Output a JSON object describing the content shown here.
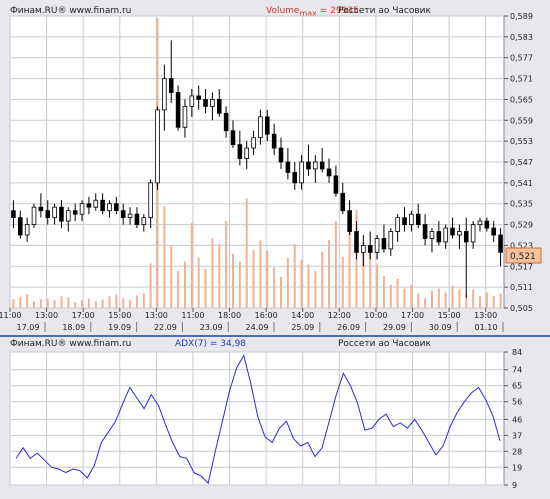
{
  "top_panel": {
    "source": "Финам.RU®  www.finam.ru",
    "volume_label_prefix": "Volume",
    "volume_label_sub": "max",
    "volume_label_value": " = 29935",
    "instrument": "Россети ао Часовик",
    "last_price": "0,521"
  },
  "bottom_panel": {
    "source": "Финам.RU®  www.finam.ru",
    "indicator": "ADX(7) = 34,98",
    "instrument": "Россети ао Часовик"
  },
  "colors": {
    "up_body": "#ffffff",
    "down_body": "#000000",
    "volume": "#f2b190",
    "adx_line": "#2b2bd8",
    "grid": "#c9c9d2",
    "price_box": "#f6c29d",
    "sep": "#4a6fb0"
  },
  "chart_data": [
    {
      "type": "candlestick",
      "title": "Россети ао Часовик",
      "y_ticks": [
        "0,589",
        "0,583",
        "0,577",
        "0,571",
        "0,565",
        "0,559",
        "0,553",
        "0,547",
        "0,541",
        "0,535",
        "0,529",
        "0,523",
        "0,517",
        "0,511",
        "0,505"
      ],
      "ylim": [
        0.505,
        0.589
      ],
      "time_labels": [
        "11:00",
        "13:00",
        "17:00",
        "15:00",
        "13:00",
        "11:00",
        "18:00",
        "16:00",
        "14:00",
        "12:00",
        "10:00",
        "17:00",
        "15:00",
        "13:00"
      ],
      "date_labels": [
        "17.09",
        "18.09",
        "19.09",
        "22.09",
        "23.09",
        "24.09",
        "25.09",
        "26.09",
        "29.09",
        "30.09",
        "01.10"
      ],
      "candles": [
        [
          0.533,
          0.536,
          0.528,
          0.531
        ],
        [
          0.531,
          0.533,
          0.525,
          0.526
        ],
        [
          0.526,
          0.531,
          0.524,
          0.529
        ],
        [
          0.529,
          0.535,
          0.528,
          0.534
        ],
        [
          0.534,
          0.538,
          0.531,
          0.533
        ],
        [
          0.533,
          0.536,
          0.529,
          0.531
        ],
        [
          0.531,
          0.535,
          0.529,
          0.534
        ],
        [
          0.534,
          0.536,
          0.528,
          0.53
        ],
        [
          0.53,
          0.534,
          0.527,
          0.533
        ],
        [
          0.533,
          0.535,
          0.53,
          0.532
        ],
        [
          0.532,
          0.536,
          0.53,
          0.535
        ],
        [
          0.535,
          0.537,
          0.532,
          0.534
        ],
        [
          0.534,
          0.538,
          0.533,
          0.536
        ],
        [
          0.536,
          0.538,
          0.532,
          0.533
        ],
        [
          0.533,
          0.536,
          0.531,
          0.535
        ],
        [
          0.535,
          0.537,
          0.532,
          0.533
        ],
        [
          0.533,
          0.535,
          0.529,
          0.531
        ],
        [
          0.531,
          0.534,
          0.529,
          0.532
        ],
        [
          0.532,
          0.534,
          0.528,
          0.529
        ],
        [
          0.529,
          0.532,
          0.527,
          0.531
        ],
        [
          0.531,
          0.542,
          0.528,
          0.541
        ],
        [
          0.541,
          0.563,
          0.539,
          0.562
        ],
        [
          0.562,
          0.575,
          0.556,
          0.571
        ],
        [
          0.571,
          0.582,
          0.564,
          0.567
        ],
        [
          0.567,
          0.569,
          0.556,
          0.557
        ],
        [
          0.557,
          0.565,
          0.554,
          0.563
        ],
        [
          0.563,
          0.568,
          0.56,
          0.566
        ],
        [
          0.566,
          0.569,
          0.562,
          0.565
        ],
        [
          0.565,
          0.568,
          0.561,
          0.563
        ],
        [
          0.563,
          0.567,
          0.559,
          0.565
        ],
        [
          0.565,
          0.568,
          0.56,
          0.561
        ],
        [
          0.561,
          0.563,
          0.554,
          0.556
        ],
        [
          0.556,
          0.559,
          0.551,
          0.552
        ],
        [
          0.552,
          0.556,
          0.546,
          0.548
        ],
        [
          0.548,
          0.553,
          0.545,
          0.551
        ],
        [
          0.551,
          0.556,
          0.549,
          0.554
        ],
        [
          0.554,
          0.562,
          0.552,
          0.56
        ],
        [
          0.56,
          0.562,
          0.553,
          0.555
        ],
        [
          0.555,
          0.558,
          0.549,
          0.551
        ],
        [
          0.551,
          0.554,
          0.545,
          0.547
        ],
        [
          0.547,
          0.551,
          0.542,
          0.544
        ],
        [
          0.544,
          0.547,
          0.539,
          0.541
        ],
        [
          0.541,
          0.549,
          0.539,
          0.547
        ],
        [
          0.547,
          0.552,
          0.543,
          0.545
        ],
        [
          0.545,
          0.549,
          0.541,
          0.547
        ],
        [
          0.547,
          0.551,
          0.544,
          0.545
        ],
        [
          0.545,
          0.548,
          0.541,
          0.543
        ],
        [
          0.543,
          0.546,
          0.537,
          0.538
        ],
        [
          0.538,
          0.541,
          0.532,
          0.533
        ],
        [
          0.533,
          0.536,
          0.526,
          0.527
        ],
        [
          0.527,
          0.53,
          0.519,
          0.521
        ],
        [
          0.521,
          0.526,
          0.517,
          0.523
        ],
        [
          0.523,
          0.527,
          0.519,
          0.521
        ],
        [
          0.521,
          0.526,
          0.519,
          0.525
        ],
        [
          0.525,
          0.529,
          0.521,
          0.522
        ],
        [
          0.522,
          0.528,
          0.52,
          0.527
        ],
        [
          0.527,
          0.532,
          0.524,
          0.531
        ],
        [
          0.531,
          0.534,
          0.527,
          0.529
        ],
        [
          0.529,
          0.533,
          0.527,
          0.532
        ],
        [
          0.532,
          0.535,
          0.528,
          0.529
        ],
        [
          0.529,
          0.532,
          0.523,
          0.525
        ],
        [
          0.525,
          0.528,
          0.521,
          0.527
        ],
        [
          0.527,
          0.53,
          0.523,
          0.524
        ],
        [
          0.524,
          0.529,
          0.522,
          0.528
        ],
        [
          0.528,
          0.531,
          0.525,
          0.526
        ],
        [
          0.526,
          0.529,
          0.522,
          0.527
        ],
        [
          0.527,
          0.531,
          0.508,
          0.524
        ],
        [
          0.524,
          0.53,
          0.522,
          0.529
        ],
        [
          0.529,
          0.531,
          0.527,
          0.53
        ],
        [
          0.53,
          0.531,
          0.527,
          0.528
        ],
        [
          0.528,
          0.53,
          0.524,
          0.526
        ],
        [
          0.526,
          0.528,
          0.517,
          0.521
        ]
      ],
      "volume": [
        900,
        1100,
        1400,
        700,
        900,
        1000,
        800,
        1200,
        1100,
        600,
        800,
        1000,
        700,
        900,
        1200,
        1400,
        1000,
        800,
        1300,
        1500,
        4600,
        29935,
        10500,
        6500,
        3800,
        4800,
        8800,
        5200,
        4000,
        7200,
        6600,
        9000,
        5600,
        4800,
        11300,
        6000,
        7000,
        5900,
        4200,
        3200,
        5200,
        6600,
        5000,
        4500,
        3800,
        5800,
        7000,
        9000,
        5300,
        8700,
        10100,
        6800,
        5900,
        4500,
        3300,
        2400,
        3000,
        2000,
        2400,
        1500,
        1000,
        1800,
        2000,
        1600,
        2300,
        1900,
        1400,
        1900,
        1200,
        1600,
        1200,
        1500
      ]
    },
    {
      "type": "line",
      "title": "ADX(7) = 34,98",
      "y_ticks": [
        "84",
        "74",
        "65",
        "56",
        "46",
        "37",
        "28",
        "19",
        "9"
      ],
      "ylim": [
        9,
        84
      ],
      "series": [
        {
          "name": "ADX(7)",
          "values": [
            24,
            30,
            24,
            27,
            23,
            19,
            18,
            16,
            18,
            17,
            13,
            20,
            33,
            39,
            45,
            55,
            64,
            58,
            52,
            60,
            54,
            43,
            33,
            25,
            24,
            16,
            14,
            10,
            28,
            45,
            62,
            75,
            82,
            66,
            47,
            36,
            33,
            41,
            45,
            35,
            31,
            33,
            25,
            30,
            45,
            60,
            72,
            65,
            55,
            40,
            41,
            46,
            49,
            42,
            44,
            41,
            46,
            40,
            33,
            26,
            31,
            42,
            50,
            56,
            61,
            64,
            57,
            48,
            34
          ]
        }
      ]
    }
  ]
}
